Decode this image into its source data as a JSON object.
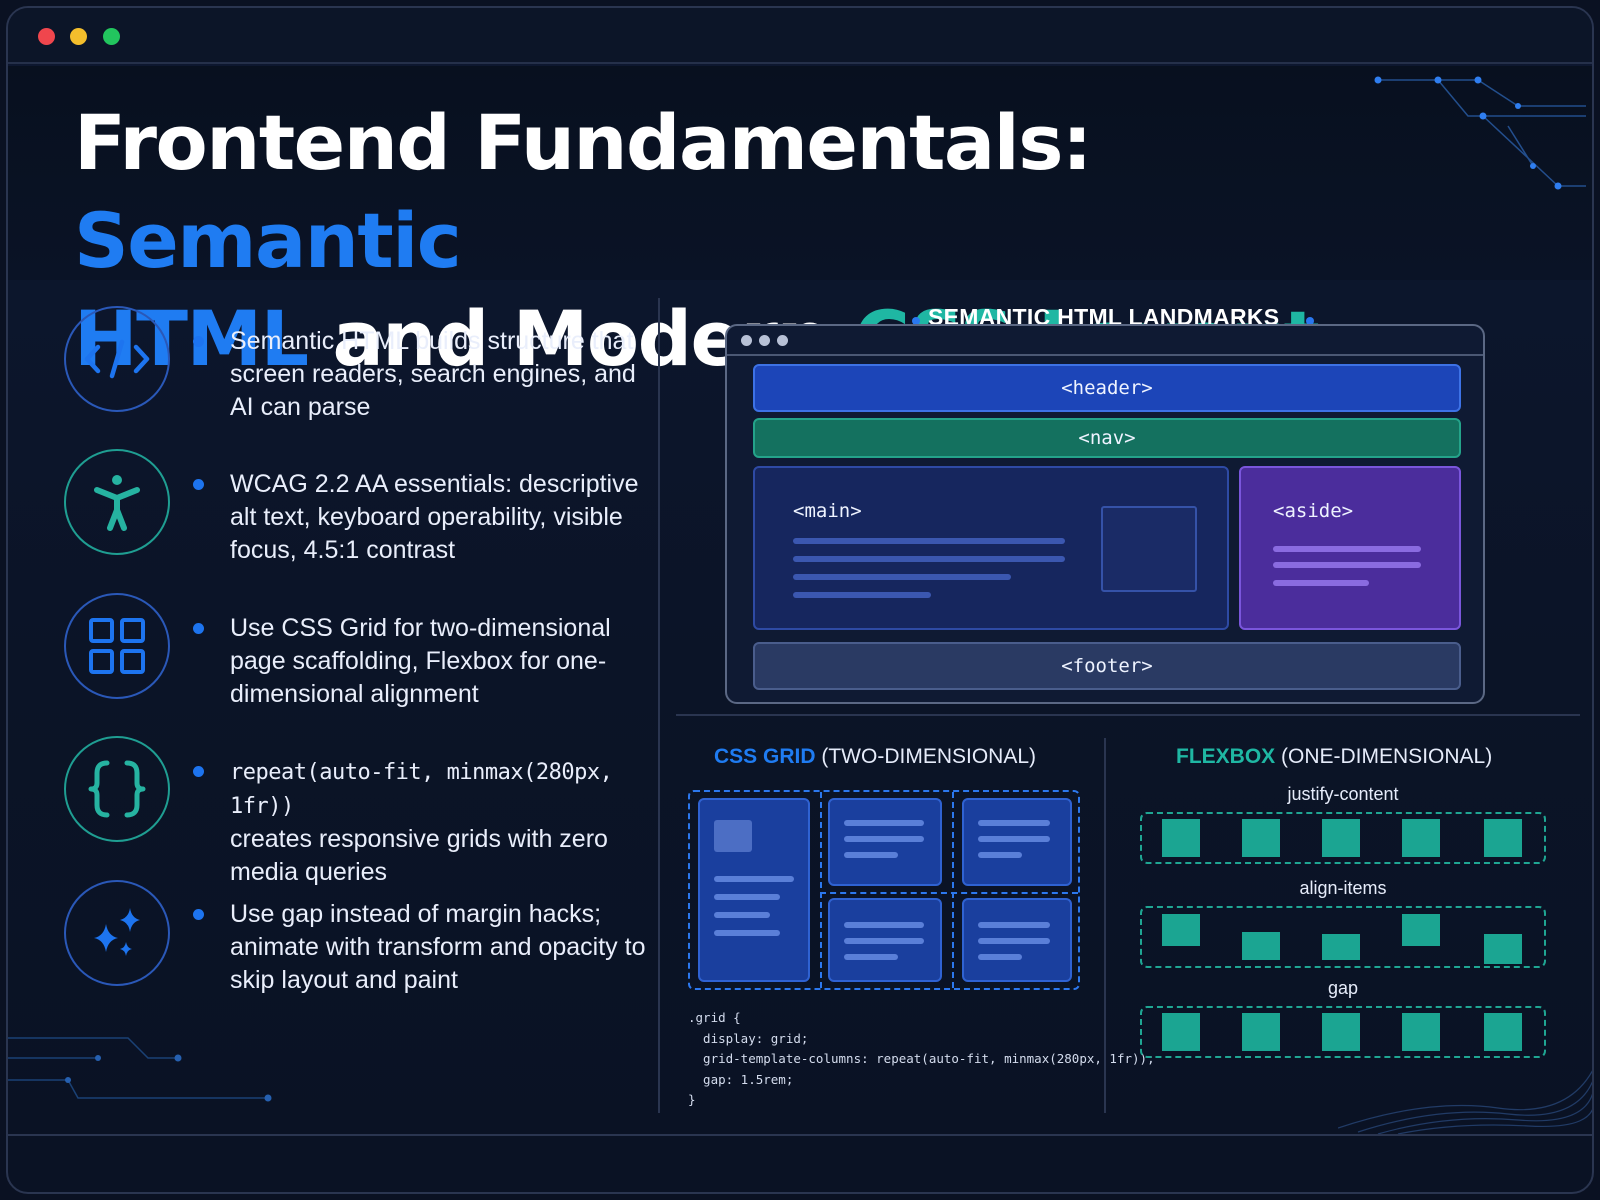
{
  "title": {
    "part1": "Frontend Fundamentals: ",
    "part2": "Semantic",
    "part3": "HTML",
    "part4": " and Modern ",
    "part5": "CSS Layout"
  },
  "bullets": [
    {
      "icon": "code-icon",
      "text": "Semantic HTML builds structure that screen readers, search engines, and AI can parse"
    },
    {
      "icon": "accessibility-icon",
      "text": "WCAG 2.2 AA essentials: descriptive alt text, keyboard operability, visible focus, 4.5:1 contrast"
    },
    {
      "icon": "grid-icon",
      "text": "Use CSS Grid for two-dimensional page scaffolding, Flexbox for one-dimensional alignment"
    },
    {
      "icon": "braces-icon",
      "code": "repeat(auto-fit, minmax(280px, 1fr))",
      "text": "creates responsive grids with zero media queries"
    },
    {
      "icon": "sparkles-icon",
      "text": "Use gap instead of margin hacks; animate with transform and opacity to skip layout and paint"
    }
  ],
  "landmarks": {
    "title": "SEMANTIC HTML LANDMARKS",
    "header": "<header>",
    "nav": "<nav>",
    "main": "<main>",
    "aside": "<aside>",
    "footer": "<footer>"
  },
  "css_grid": {
    "title_strong": "CSS GRID",
    "title_rest": " (TWO-DIMENSIONAL)",
    "code": ".grid {\n  display: grid;\n  grid-template-columns: repeat(auto-fit, minmax(280px, 1fr));\n  gap: 1.5rem;\n}"
  },
  "flexbox": {
    "title_strong": "FLEXBOX",
    "title_rest": " (ONE-DIMENSIONAL)",
    "rows": [
      "justify-content",
      "align-items",
      "gap"
    ]
  },
  "colors": {
    "blue": "#1f7cf2",
    "teal": "#1fb7a3",
    "purple": "#4b2d9c",
    "background": "#0b1427"
  }
}
